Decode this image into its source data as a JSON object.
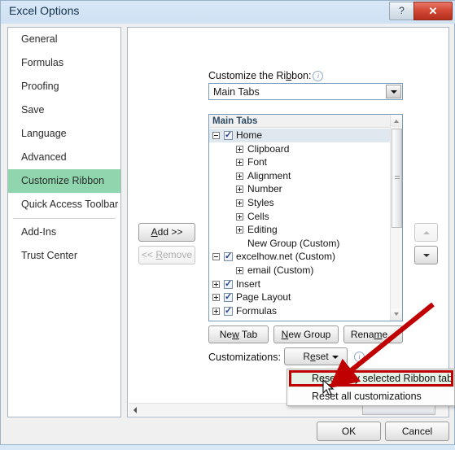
{
  "window": {
    "title": "Excel Options",
    "help_label": "?",
    "close_label": "✕"
  },
  "sidebar": {
    "items": [
      {
        "label": "General",
        "selected": false
      },
      {
        "label": "Formulas",
        "selected": false
      },
      {
        "label": "Proofing",
        "selected": false
      },
      {
        "label": "Save",
        "selected": false
      },
      {
        "label": "Language",
        "selected": false
      },
      {
        "label": "Advanced",
        "selected": false
      },
      {
        "label": "Customize Ribbon",
        "selected": true
      },
      {
        "label": "Quick Access Toolbar",
        "selected": false
      },
      {
        "label": "Add-Ins",
        "selected": false
      },
      {
        "label": "Trust Center",
        "selected": false
      }
    ],
    "selected_color": "#8fd6ae"
  },
  "main": {
    "ribbon_label_pre": "Customize the Ri",
    "ribbon_label_acc": "b",
    "ribbon_label_post": "bon:",
    "info_glyph": "i",
    "dropdown_value": "Main Tabs",
    "tree_header": "Main Tabs",
    "tree_rows": [
      {
        "label": "Home",
        "indent": 0,
        "expander": "minus",
        "checkbox": true,
        "selected": true
      },
      {
        "label": "Clipboard",
        "indent": 1,
        "expander": "plus",
        "checkbox": false,
        "selected": false
      },
      {
        "label": "Font",
        "indent": 1,
        "expander": "plus",
        "checkbox": false,
        "selected": false
      },
      {
        "label": "Alignment",
        "indent": 1,
        "expander": "plus",
        "checkbox": false,
        "selected": false
      },
      {
        "label": "Number",
        "indent": 1,
        "expander": "plus",
        "checkbox": false,
        "selected": false
      },
      {
        "label": "Styles",
        "indent": 1,
        "expander": "plus",
        "checkbox": false,
        "selected": false
      },
      {
        "label": "Cells",
        "indent": 1,
        "expander": "plus",
        "checkbox": false,
        "selected": false
      },
      {
        "label": "Editing",
        "indent": 1,
        "expander": "plus",
        "checkbox": false,
        "selected": false
      },
      {
        "label": "New Group (Custom)",
        "indent": 1,
        "expander": "none",
        "checkbox": false,
        "selected": false
      },
      {
        "label": "excelhow.net (Custom)",
        "indent": 0,
        "expander": "minus",
        "checkbox": true,
        "selected": false
      },
      {
        "label": "email (Custom)",
        "indent": 1,
        "expander": "plus",
        "checkbox": false,
        "selected": false
      },
      {
        "label": "Insert",
        "indent": 0,
        "expander": "plus",
        "checkbox": true,
        "selected": false
      },
      {
        "label": "Page Layout",
        "indent": 0,
        "expander": "plus",
        "checkbox": true,
        "selected": false
      },
      {
        "label": "Formulas",
        "indent": 0,
        "expander": "plus",
        "checkbox": true,
        "selected": false
      }
    ],
    "add_button": "Add >>",
    "add_acc": "A",
    "remove_button": "<< Remove",
    "remove_acc": "R",
    "move_up": "▲",
    "move_down": "▼",
    "new_tab_pre": "Ne",
    "new_tab_acc": "w",
    "new_tab_post": " Tab",
    "new_group_acc": "N",
    "new_group_post": "ew Group",
    "rename_pre": "Rena",
    "rename_acc": "m",
    "rename_post": "e...",
    "customizations_label": "Customizations:",
    "reset_pre": "R",
    "reset_acc": "e",
    "reset_post": "set"
  },
  "reset_menu": {
    "items": [
      {
        "label": "Reset only selected Ribbon tab",
        "highlighted": true
      },
      {
        "label": "Reset all customizations",
        "highlighted": false
      }
    ]
  },
  "footer": {
    "ok": "OK",
    "cancel": "Cancel"
  },
  "annotation": {
    "color": "#c00000"
  }
}
